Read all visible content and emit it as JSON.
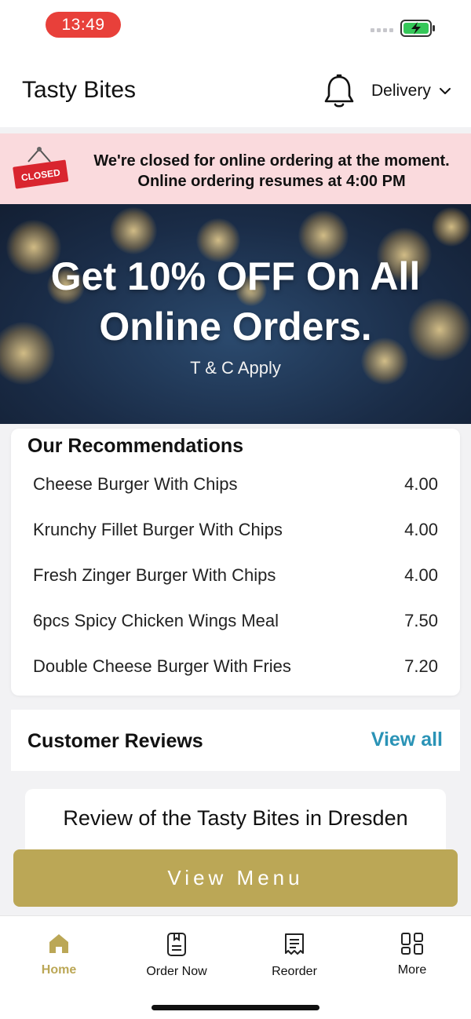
{
  "status": {
    "time": "13:49"
  },
  "header": {
    "title": "Tasty Bites",
    "delivery_label": "Delivery"
  },
  "closed_banner": {
    "sign_text": "CLOSED",
    "line1": "We're closed for online ordering at the moment.",
    "line2": "Online ordering resumes at 4:00 PM"
  },
  "promo": {
    "line1": "Get 10% OFF On All",
    "line2": "Online Orders.",
    "sub": "T & C Apply"
  },
  "recommendations": {
    "title": "Our Recommendations",
    "items": [
      {
        "name": "Cheese Burger With Chips",
        "price": "4.00"
      },
      {
        "name": "Krunchy Fillet Burger With Chips",
        "price": "4.00"
      },
      {
        "name": "Fresh Zinger Burger With Chips",
        "price": "4.00"
      },
      {
        "name": "6pcs Spicy Chicken Wings Meal",
        "price": "7.50"
      },
      {
        "name": "Double Cheese Burger With Fries",
        "price": "7.20"
      }
    ]
  },
  "reviews": {
    "title": "Customer Reviews",
    "view_all": "View all",
    "card_title": "Review of the Tasty Bites in Dresden"
  },
  "view_menu": "View Menu",
  "tabs": [
    {
      "label": "Home",
      "icon": "home-icon"
    },
    {
      "label": "Order Now",
      "icon": "order-icon"
    },
    {
      "label": "Reorder",
      "icon": "receipt-icon"
    },
    {
      "label": "More",
      "icon": "grid-icon"
    }
  ],
  "colors": {
    "accent": "#bba756",
    "link": "#2a93b6",
    "banner": "#fadadd",
    "time_pill": "#e8403a"
  }
}
